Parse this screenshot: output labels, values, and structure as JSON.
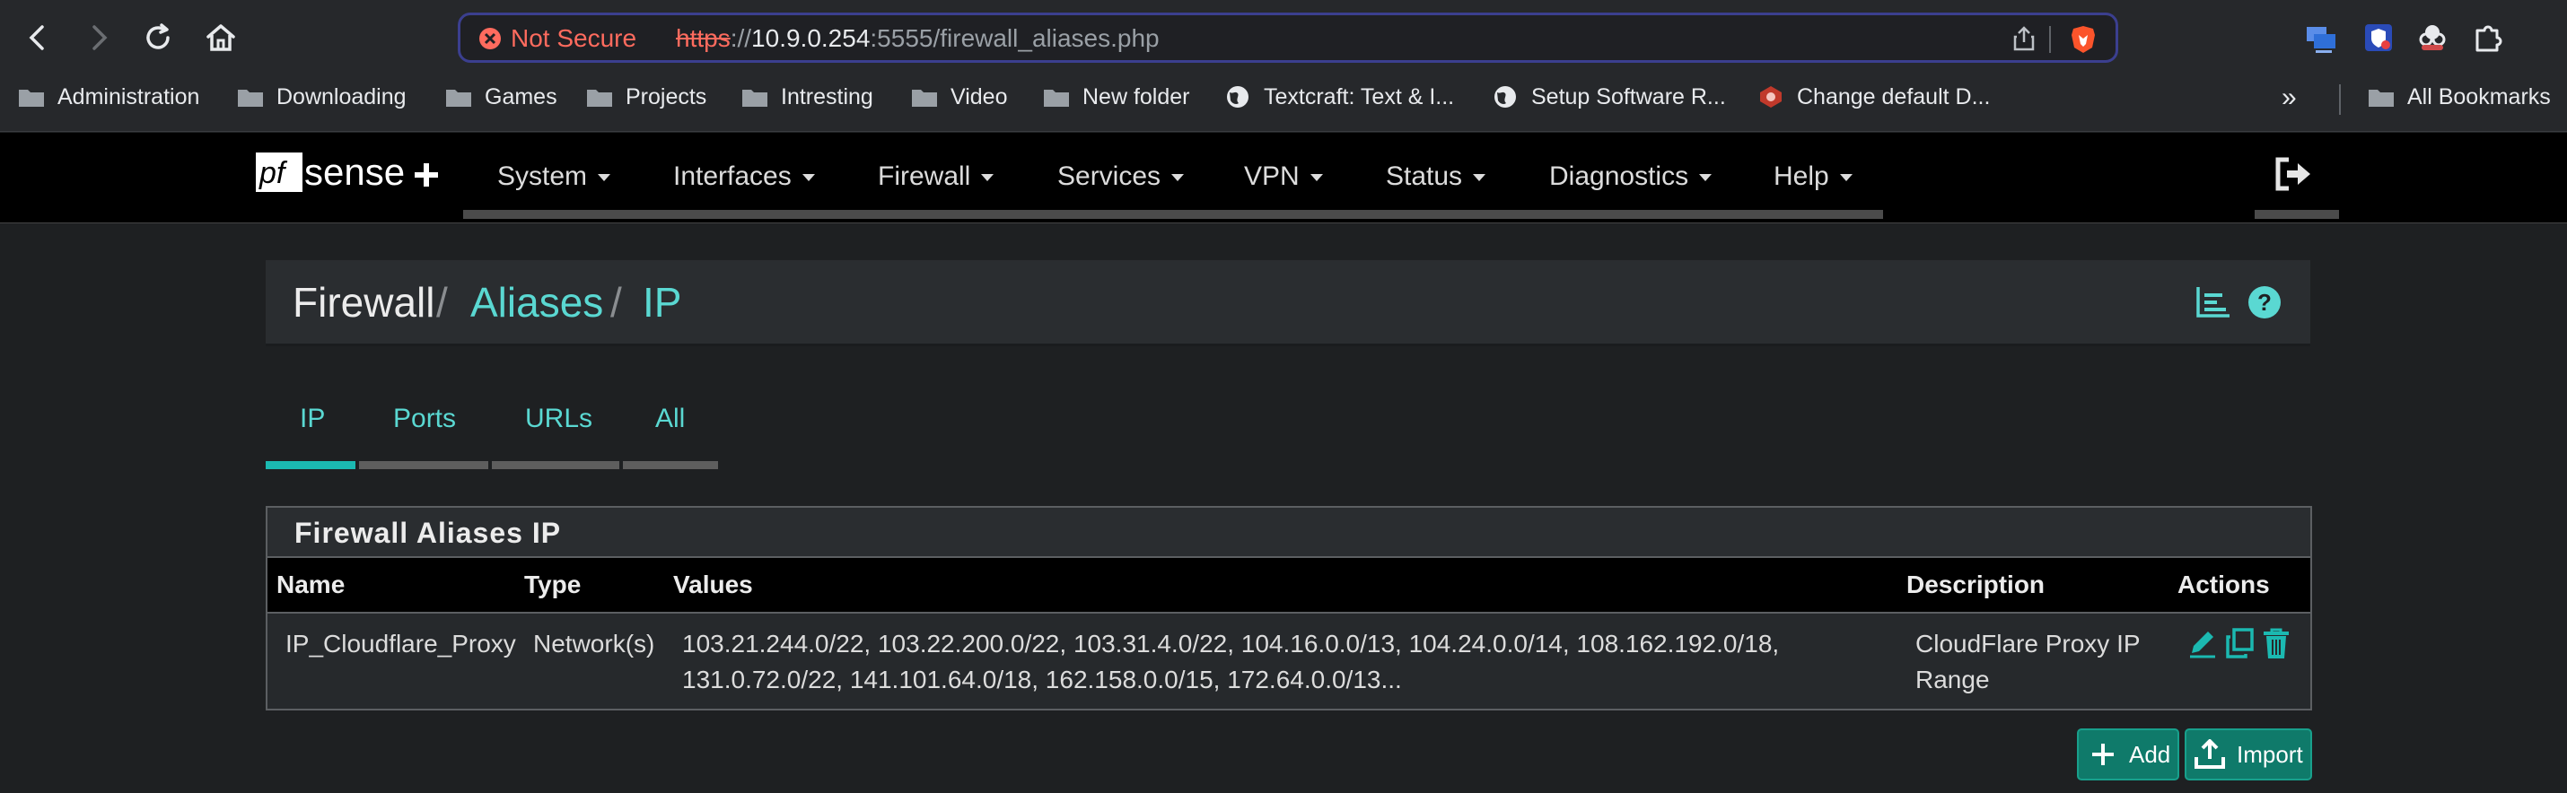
{
  "browser": {
    "security_label": "Not Secure",
    "url_scheme": "https",
    "url_sep": "://",
    "url_host": "10.9.0.254",
    "url_rest": ":5555/firewall_aliases.php",
    "bookmarks": [
      {
        "label": "Administration",
        "icon": "folder-icon"
      },
      {
        "label": "Downloading",
        "icon": "folder-icon"
      },
      {
        "label": "Games",
        "icon": "folder-icon"
      },
      {
        "label": "Projects",
        "icon": "folder-icon"
      },
      {
        "label": "Intresting",
        "icon": "folder-icon"
      },
      {
        "label": "Video",
        "icon": "folder-icon"
      },
      {
        "label": "New folder",
        "icon": "folder-icon"
      },
      {
        "label": "Textcraft: Text & I...",
        "icon": "globe-icon"
      },
      {
        "label": "Setup Software R...",
        "icon": "globe-icon"
      },
      {
        "label": "Change default D...",
        "icon": "site-icon"
      }
    ],
    "overflow_chevron": "»",
    "all_bookmarks": "All Bookmarks"
  },
  "nav": {
    "items": [
      "System",
      "Interfaces",
      "Firewall",
      "Services",
      "VPN",
      "Status",
      "Diagnostics",
      "Help"
    ]
  },
  "breadcrumb": {
    "root": "Firewall",
    "sep": "/",
    "section": "Aliases",
    "current": "IP"
  },
  "tabs": [
    "IP",
    "Ports",
    "URLs",
    "All"
  ],
  "panel": {
    "title": "Firewall Aliases IP",
    "columns": [
      "Name",
      "Type",
      "Values",
      "Description",
      "Actions"
    ],
    "rows": [
      {
        "name": "IP_Cloudflare_Proxy",
        "type": "Network(s)",
        "values_line1": "103.21.244.0/22, 103.22.200.0/22, 103.31.4.0/22, 104.16.0.0/13, 104.24.0.0/14, 108.162.192.0/18,",
        "values_line2": "131.0.72.0/22, 141.101.64.0/18, 162.158.0.0/15, 172.64.0.0/13...",
        "description_line1": "CloudFlare Proxy IP",
        "description_line2": "Range"
      }
    ]
  },
  "buttons": {
    "add": "Add",
    "import": "Import"
  },
  "colors": {
    "accent": "#5ad8d2",
    "tab_active": "#1bb9b1",
    "button": "#0f7a6a",
    "warning": "#ff6b5e"
  }
}
